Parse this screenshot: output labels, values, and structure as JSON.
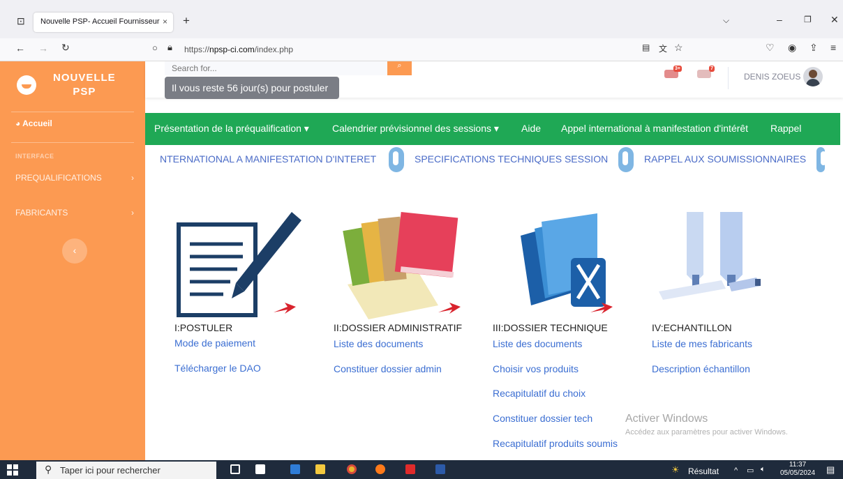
{
  "browser": {
    "tab_title": "Nouvelle PSP- Accueil Fournisseur",
    "tab_close": "×",
    "new_tab": "+",
    "url_scheme": "https://",
    "url_host": "npsp-ci.com",
    "url_path": "/index.php"
  },
  "sidebar": {
    "brand_line1": "NOUVELLE",
    "brand_line2": "PSP",
    "home_label": "Accueil",
    "section_label": "INTERFACE",
    "items": [
      {
        "label": "PREQUALIFICATIONS",
        "chevron": "›"
      },
      {
        "label": "FABRICANTS",
        "chevron": "›"
      }
    ],
    "toggle": "‹"
  },
  "topbar": {
    "search_placeholder": "Search for...",
    "tooltip": "Il vous reste 56 jour(s) pour postuler",
    "alerts_badge": "3+",
    "messages_badge": "7",
    "username": "DENIS ZOEUS"
  },
  "menu": [
    "Présentation de la préqualification ▾",
    "Calendrier prévisionnel des sessions ▾",
    "Aide",
    "Appel international à manifestation d'intérêt",
    "Rappel"
  ],
  "marquee": [
    "NTERNATIONAL A MANIFESTATION D'INTERET",
    "SPECIFICATIONS TECHNIQUES SESSION",
    "RAPPEL AUX SOUMISSIONNAIRES"
  ],
  "cards": [
    {
      "title": "I:POSTULER",
      "links": [
        "Mode de paiement",
        "Télécharger le DAO"
      ]
    },
    {
      "title": "II:DOSSIER ADMINISTRATIF",
      "links": [
        "Liste des documents",
        "Constituer dossier admin"
      ]
    },
    {
      "title": "III:DOSSIER TECHNIQUE",
      "links": [
        "Liste des documents",
        "Choisir vos produits",
        "Recapitulatif du choix",
        "Constituer dossier tech",
        "Recapitulatif produits soumis"
      ]
    },
    {
      "title": "IV:ECHANTILLON",
      "links": [
        "Liste de mes fabricants",
        "Description échantillon"
      ]
    }
  ],
  "watermark": {
    "title": "Activer Windows",
    "subtitle": "Accédez aux paramètres pour activer Windows."
  },
  "taskbar": {
    "search_placeholder": "Taper ici pour rechercher",
    "result_label": "Résultat",
    "time": "11:37",
    "date": "05/05/2024"
  },
  "colors": {
    "sidebar": "#fc9a52",
    "menu": "#1fa855",
    "link": "#3b6ed2",
    "arrow": "#d9232d"
  }
}
